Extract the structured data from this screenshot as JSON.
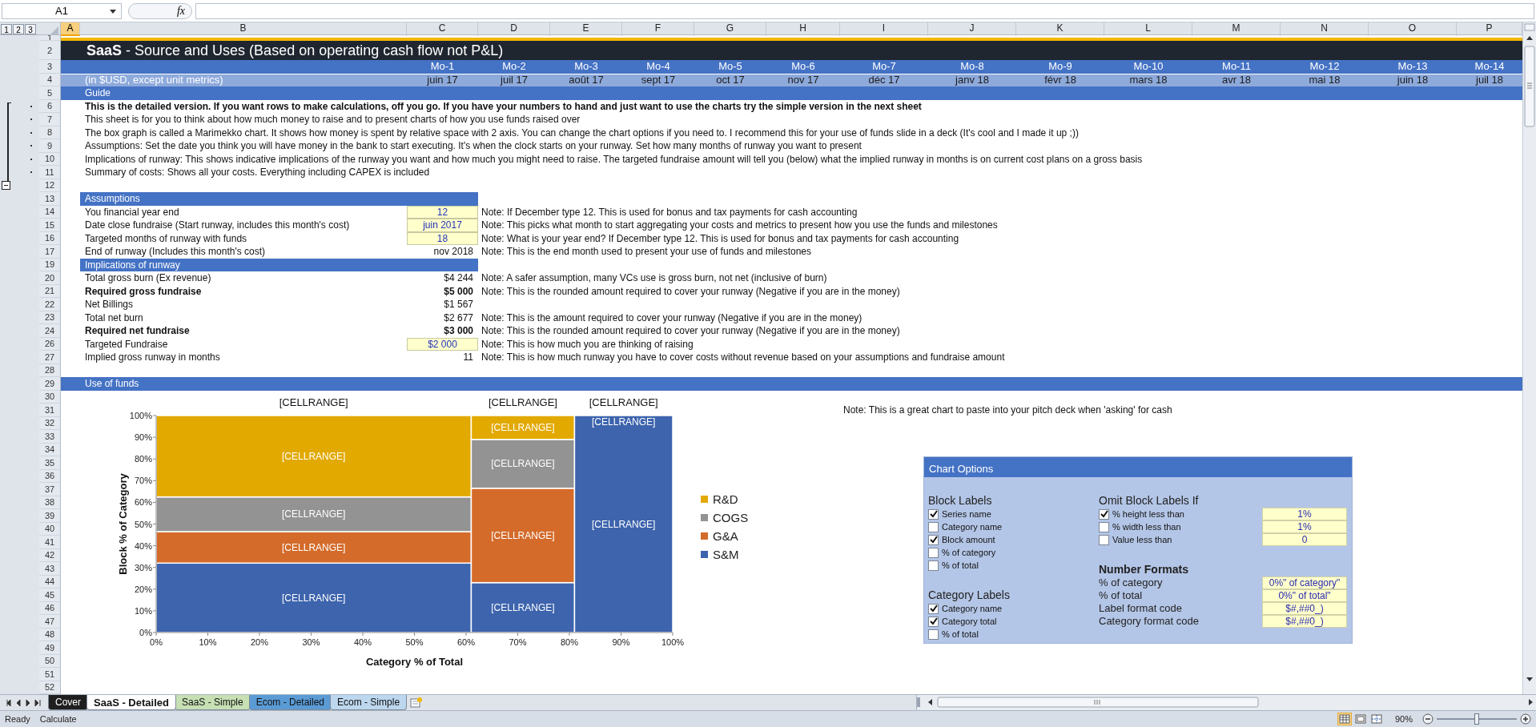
{
  "formula_bar": {
    "name_box": "A1",
    "function_label": "fx"
  },
  "outline": {
    "levels": [
      "1",
      "2",
      "3"
    ]
  },
  "columns": [
    {
      "letter": "A",
      "selected": true
    },
    {
      "letter": "B",
      "selected": false
    },
    {
      "letter": "C",
      "selected": false
    },
    {
      "letter": "D",
      "selected": false
    },
    {
      "letter": "E",
      "selected": false
    },
    {
      "letter": "F",
      "selected": false
    },
    {
      "letter": "G",
      "selected": false
    },
    {
      "letter": "H",
      "selected": false
    },
    {
      "letter": "I",
      "selected": false
    },
    {
      "letter": "J",
      "selected": false
    },
    {
      "letter": "K",
      "selected": false
    },
    {
      "letter": "L",
      "selected": false
    },
    {
      "letter": "M",
      "selected": false
    },
    {
      "letter": "N",
      "selected": false
    },
    {
      "letter": "O",
      "selected": false
    },
    {
      "letter": "P",
      "selected": false
    }
  ],
  "rows": [
    {
      "num": "1",
      "kind": "topline",
      "grouped": false
    },
    {
      "num": "2",
      "kind": "title",
      "text": "**SaaS** - Source and Uses (Based on operating cash flow not P&L)",
      "grouped": false
    },
    {
      "num": "3",
      "kind": "month_numbers",
      "months": [
        "Mo-1",
        "Mo-2",
        "Mo-3",
        "Mo-4",
        "Mo-5",
        "Mo-6",
        "Mo-7",
        "Mo-8",
        "Mo-9",
        "Mo-10",
        "Mo-11",
        "Mo-12",
        "Mo-13",
        "Mo-14"
      ],
      "grouped": false
    },
    {
      "num": "4",
      "kind": "month_dates",
      "label": "(in $USD, except unit metrics)",
      "months": [
        "juin 17",
        "juil 17",
        "août 17",
        "sept 17",
        "oct 17",
        "nov 17",
        "déc 17",
        "janv 18",
        "févr 18",
        "mars 18",
        "avr 18",
        "mai 18",
        "juin 18",
        "juil 18"
      ],
      "grouped": false
    },
    {
      "num": "5",
      "kind": "band",
      "label": "Guide",
      "grouped": false
    },
    {
      "num": "6",
      "kind": "text",
      "bold": true,
      "text": "This is the detailed version. If you want rows to make calculations, off you go. If you have your numbers to hand and just want to use the charts try the simple version in the next sheet",
      "grouped": true
    },
    {
      "num": "7",
      "kind": "text",
      "bold": false,
      "text": "This sheet is for you to think about how much money to raise and to present charts of how you use funds raised over",
      "grouped": true
    },
    {
      "num": "8",
      "kind": "text",
      "bold": false,
      "text": "The box graph is called a Marimekko chart. It shows how money is spent by relative space with 2 axis. You can change the chart options if you need to. I recommend this for your use of funds slide in a deck (It's cool and I made it up ;))",
      "grouped": true
    },
    {
      "num": "9",
      "kind": "text",
      "bold": false,
      "text": "Assumptions: Set the date you think you will have money in the bank to start executing. It's when the clock starts on your runway. Set how many months of runway you want to present",
      "grouped": true
    },
    {
      "num": "10",
      "kind": "text",
      "bold": false,
      "text": "Implications of runway: This shows indicative implications of the runway you want and how much you might need to raise. The targeted fundraise amount will tell you (below) what the implied runway in months is on current cost plans on a gross basis",
      "grouped": true
    },
    {
      "num": "11",
      "kind": "text",
      "bold": false,
      "text": "Summary of costs: Shows all your costs. Everything including CAPEX is included",
      "grouped": true
    },
    {
      "num": "12",
      "kind": "empty",
      "grouped": false
    },
    {
      "num": "13",
      "kind": "band_short",
      "label": "Assumptions",
      "grouped": false
    },
    {
      "num": "14",
      "kind": "item",
      "label": "You financial year end",
      "bold": false,
      "value": "12",
      "input": true,
      "note": "Note: If December type 12. This is used for bonus and tax payments for cash accounting",
      "grouped": false
    },
    {
      "num": "15",
      "kind": "item",
      "label": "Date close fundraise (Start runway, includes this month's cost)",
      "bold": false,
      "value": "juin 2017",
      "input": true,
      "note": "Note: This picks what month to start aggregating your costs and metrics to present how you use the funds and milestones",
      "grouped": false
    },
    {
      "num": "16",
      "kind": "item",
      "label": "Targeted months of runway with funds",
      "bold": false,
      "value": "18",
      "input": true,
      "note": "Note: What is your year end? If December type 12. This is used for bonus and tax payments for cash accounting",
      "grouped": false
    },
    {
      "num": "17",
      "kind": "item",
      "label": "End of runway (Includes this month's cost)",
      "bold": false,
      "value": "nov 2018",
      "input": false,
      "note": "Note: This is the end month used to present your use of funds and milestones",
      "grouped": false
    },
    {
      "num": "19",
      "kind": "band_short",
      "label": "Implications of runway",
      "grouped": false
    },
    {
      "num": "20",
      "kind": "item",
      "label": "Total gross burn (Ex revenue)",
      "bold": false,
      "value": "$4 244",
      "input": false,
      "note": "Note: A safer assumption, many VCs use is gross burn, not net (inclusive of burn)",
      "grouped": false
    },
    {
      "num": "21",
      "kind": "item",
      "label": "Required gross fundraise",
      "bold": true,
      "value": "$5 000",
      "input": false,
      "note": "Note: This is the rounded amount required to cover your runway (Negative if you are in the money)",
      "grouped": false
    },
    {
      "num": "22",
      "kind": "item",
      "label": "Net Billings",
      "bold": false,
      "value": "$1 567",
      "input": false,
      "grouped": false
    },
    {
      "num": "23",
      "kind": "item",
      "label": "Total net burn",
      "bold": false,
      "value": "$2 677",
      "input": false,
      "note": "Note: This is the amount required to cover your runway (Negative if you are in the money)",
      "grouped": false
    },
    {
      "num": "24",
      "kind": "item",
      "label": "Required net fundraise",
      "bold": true,
      "value": "$3 000",
      "input": false,
      "note": "Note: This is the rounded amount required to cover your runway (Negative if you are in the money)",
      "grouped": false
    },
    {
      "num": "26",
      "kind": "item",
      "label": "Targeted Fundraise",
      "bold": false,
      "value": "$2 000",
      "input": true,
      "note": "Note: This is how much you are thinking of raising",
      "grouped": false
    },
    {
      "num": "27",
      "kind": "item",
      "label": "Implied gross runway in months",
      "bold": false,
      "value": "11",
      "input": false,
      "note": "Note: This is how much runway you have to cover costs without revenue based on your assumptions and fundraise amount",
      "grouped": false
    },
    {
      "num": "28",
      "kind": "empty",
      "grouped": false
    },
    {
      "num": "29",
      "kind": "band",
      "label": "Use of funds",
      "grouped": false
    },
    {
      "num": "30",
      "kind": "empty",
      "grouped": false
    },
    {
      "num": "31",
      "kind": "note",
      "text": "Note: This is a great chart to paste into your pitch deck when 'asking' for cash",
      "grouped": false
    },
    {
      "num": "32",
      "kind": "empty",
      "grouped": false
    },
    {
      "num": "33",
      "kind": "empty",
      "grouped": false
    },
    {
      "num": "34",
      "kind": "empty",
      "grouped": false
    },
    {
      "num": "35",
      "kind": "empty",
      "grouped": false
    },
    {
      "num": "36",
      "kind": "empty",
      "grouped": false
    },
    {
      "num": "37",
      "kind": "empty",
      "grouped": false
    },
    {
      "num": "38",
      "kind": "empty",
      "grouped": false
    },
    {
      "num": "39",
      "kind": "empty",
      "grouped": false
    },
    {
      "num": "40",
      "kind": "empty",
      "grouped": false
    },
    {
      "num": "41",
      "kind": "empty",
      "grouped": false
    },
    {
      "num": "42",
      "kind": "empty",
      "grouped": false
    },
    {
      "num": "43",
      "kind": "empty",
      "grouped": false
    },
    {
      "num": "44",
      "kind": "empty",
      "grouped": false
    },
    {
      "num": "45",
      "kind": "empty",
      "grouped": false
    },
    {
      "num": "46",
      "kind": "empty",
      "grouped": false
    },
    {
      "num": "47",
      "kind": "empty",
      "grouped": false
    },
    {
      "num": "48",
      "kind": "empty",
      "grouped": false
    },
    {
      "num": "49",
      "kind": "empty",
      "grouped": false
    },
    {
      "num": "50",
      "kind": "empty",
      "grouped": false
    },
    {
      "num": "51",
      "kind": "empty",
      "grouped": false
    },
    {
      "num": "52",
      "kind": "empty",
      "grouped": false
    }
  ],
  "chart": {
    "chart_data": {
      "type": "bar",
      "stacked": true,
      "xlabel": "Category % of Total",
      "ylabel": "Block % of Category",
      "annotations": [
        "[CELLRANGE]",
        "[CELLRANGE]",
        "[CELLRANGE]"
      ],
      "x": [
        30.5,
        71,
        90.5
      ],
      "xlim": [
        0,
        100
      ],
      "ylim": [
        0,
        100
      ],
      "legend": true,
      "series": [
        {
          "name": "R&D",
          "color": "#e2a900",
          "values": [
            37.5,
            11,
            0
          ]
        },
        {
          "name": "COGS",
          "color": "#939393",
          "values": [
            16,
            22.5,
            0
          ]
        },
        {
          "name": "G&A",
          "color": "#d46b2a",
          "values": [
            14.5,
            43.5,
            0
          ]
        },
        {
          "name": "S&M",
          "color": "#3d64ad",
          "values": [
            32,
            23,
            100
          ]
        }
      ],
      "value_labels": [
        [
          "[CELLRANGE]",
          "[CELLRANGE]",
          "[CELLRANGE]"
        ],
        [
          "[CELLRANGE]",
          "[CELLRANGE]",
          null
        ],
        [
          "[CELLRANGE]",
          "[CELLRANGE]",
          null
        ],
        [
          "[CELLRANGE]",
          "[CELLRANGE]",
          "[CELLRANGE]"
        ]
      ],
      "xticks": [
        {
          "value": 0,
          "label": "0%"
        },
        {
          "value": 10,
          "label": "10%"
        },
        {
          "value": 20,
          "label": "20%"
        },
        {
          "value": 30,
          "label": "30%"
        },
        {
          "value": 40,
          "label": "40%"
        },
        {
          "value": 50,
          "label": "50%"
        },
        {
          "value": 60,
          "label": "60%"
        },
        {
          "value": 70,
          "label": "70%"
        },
        {
          "value": 80,
          "label": "80%"
        },
        {
          "value": 90,
          "label": "90%"
        },
        {
          "value": 100,
          "label": "100%"
        }
      ],
      "yticks": [
        {
          "value": 0,
          "label": "0%"
        },
        {
          "value": 10,
          "label": "10%"
        },
        {
          "value": 20,
          "label": "20%"
        },
        {
          "value": 30,
          "label": "30%"
        },
        {
          "value": 40,
          "label": "40%"
        },
        {
          "value": 50,
          "label": "50%"
        },
        {
          "value": 60,
          "label": "60%"
        },
        {
          "value": 70,
          "label": "70%"
        },
        {
          "value": 80,
          "label": "80%"
        },
        {
          "value": 90,
          "label": "90%"
        },
        {
          "value": 100,
          "label": "100%"
        }
      ]
    }
  },
  "chart_options": {
    "title": "Chart Options",
    "block_labels": {
      "title": "Block Labels",
      "options": [
        {
          "label": "Series name",
          "checked": true
        },
        {
          "label": "Category name",
          "checked": false
        },
        {
          "label": "Block amount",
          "checked": true
        },
        {
          "label": "% of category",
          "checked": false
        },
        {
          "label": "% of total",
          "checked": false
        }
      ]
    },
    "category_labels": {
      "title": "Category Labels",
      "options": [
        {
          "label": "Category name",
          "checked": true
        },
        {
          "label": "Category total",
          "checked": true
        },
        {
          "label": "% of total",
          "checked": false
        }
      ]
    },
    "omit": {
      "title": "Omit Block Labels If",
      "options": [
        {
          "label": "% height less than",
          "checked": true,
          "value": "1%"
        },
        {
          "label": "% width less than",
          "checked": false,
          "value": "1%"
        },
        {
          "label": "Value less than",
          "checked": false,
          "value": "0"
        }
      ]
    },
    "number_formats": {
      "title": "Number Formats",
      "rows": [
        {
          "label": "% of category",
          "value": "0%\" of category\""
        },
        {
          "label": "% of total",
          "value": "0%\" of total\""
        },
        {
          "label": "Label format code",
          "value": "$#,##0_)"
        },
        {
          "label": "Category format code",
          "value": "$#,##0_)"
        }
      ]
    }
  },
  "sheet_tabs": [
    {
      "label": "Cover",
      "selected": false,
      "color": "#1f1f1f"
    },
    {
      "label": "SaaS - Detailed",
      "selected": true,
      "color": "#ffffff"
    },
    {
      "label": "SaaS - Simple",
      "selected": false,
      "color": "#c6e0b4"
    },
    {
      "label": "Ecom - Detailed",
      "selected": false,
      "color": "#5b9bd5"
    },
    {
      "label": "Ecom - Simple",
      "selected": false,
      "color": "#bdd7ee"
    }
  ],
  "status_bar": {
    "mode": "Ready",
    "calc": "Calculate",
    "views": [
      {
        "kind": "normal",
        "selected": true
      },
      {
        "kind": "page_layout",
        "selected": false
      },
      {
        "kind": "page_break",
        "selected": false
      }
    ],
    "zoom": {
      "label": "90%",
      "level": 0.5
    }
  }
}
